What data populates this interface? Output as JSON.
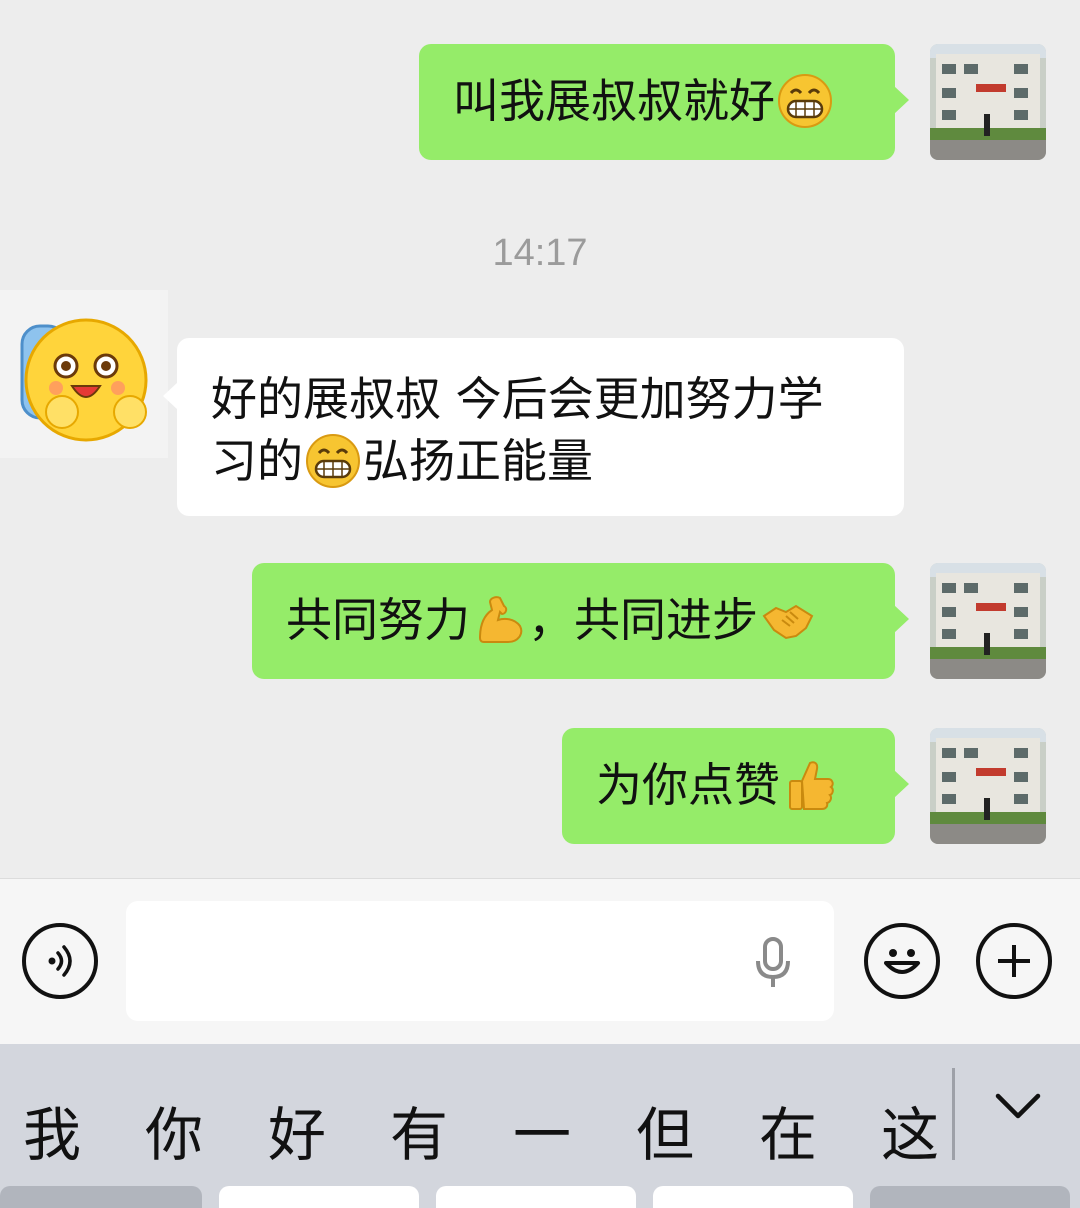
{
  "chat": {
    "messages": [
      {
        "side": "right",
        "text": "叫我展叔叔就好",
        "emoji": "grin-emoji"
      },
      {
        "type": "time",
        "text": "14:17"
      },
      {
        "side": "left",
        "line1": "好的展叔叔 今后会更加努力学",
        "line2_a": "习的",
        "line2_emoji": "grin-emoji",
        "line2_b": "弘扬正能量"
      },
      {
        "side": "right",
        "text_a": "共同努力",
        "emoji_a": "flexed-biceps-emoji",
        "text_b": "，共同进步",
        "emoji_b": "handshake-emoji"
      },
      {
        "side": "right",
        "text": "为你点赞",
        "emoji": "thumbs-up-emoji"
      }
    ]
  },
  "input_bar": {
    "voice_icon": "voice-icon",
    "mic_icon": "microphone-icon",
    "emoji_icon": "smiley-icon",
    "plus_icon": "plus-icon",
    "input_value": ""
  },
  "keyboard": {
    "candidates": [
      "我",
      "你",
      "好",
      "有",
      "一",
      "但",
      "在",
      "这"
    ],
    "collapse_icon": "chevron-down-icon"
  },
  "colors": {
    "bubble_self": "#95ec69",
    "bubble_other": "#ffffff",
    "chat_background": "#ededed",
    "keyboard_background": "#d3d6dd"
  }
}
